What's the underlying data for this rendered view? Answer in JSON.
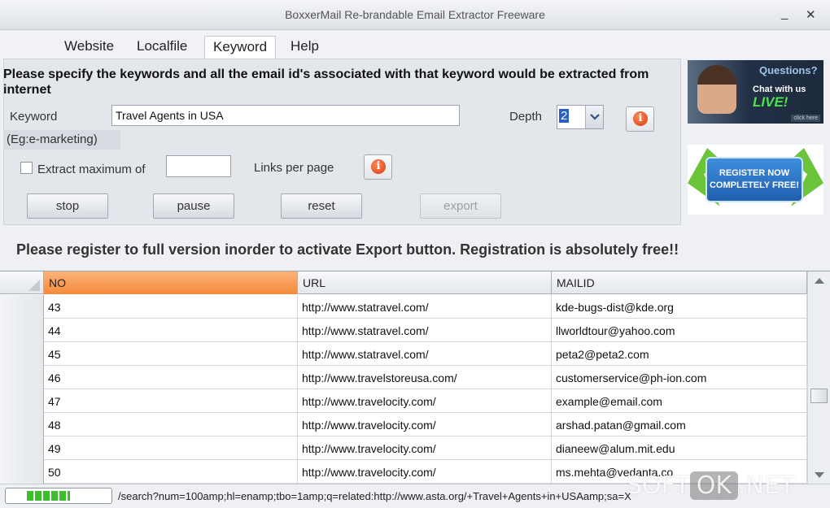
{
  "window": {
    "title": "BoxxerMail Re-brandable Email Extractor Freeware",
    "minimize": "_",
    "close": "✕"
  },
  "menu": [
    "Website",
    "Localfile",
    "Keyword",
    "Help"
  ],
  "menu_active": "Keyword",
  "keyword_panel": {
    "description": "Please specify the keywords and all the email id's associated with that keyword would be extracted from internet",
    "keyword_label": "Keyword",
    "keyword_value": "Travel Agents in USA",
    "depth_label": "Depth",
    "depth_value": "2",
    "example": "(Eg:e-marketing)",
    "extract_max_label": "Extract maximum of",
    "extract_max_value": "",
    "extract_max_checked": false,
    "links_per_page_label": "Links per page",
    "info_glyph": "i"
  },
  "buttons": {
    "stop": "stop",
    "pause": "pause",
    "reset": "reset",
    "export": "export"
  },
  "ads": {
    "questions": "Questions?",
    "chat": "Chat with us",
    "live": "LIVE!",
    "click_here": "click here",
    "register_line1": "REGISTER NOW",
    "register_line2": "COMPLETELY FREE!"
  },
  "notice": "Please register to full version inorder to activate Export button. Registration is absolutely free!!",
  "table": {
    "columns": [
      "NO",
      "URL",
      "MAILID"
    ],
    "sorted_column": "NO",
    "rows": [
      {
        "no": "43",
        "url": "http://www.statravel.com/",
        "mail": "kde-bugs-dist@kde.org"
      },
      {
        "no": "44",
        "url": "http://www.statravel.com/",
        "mail": "llworldtour@yahoo.com"
      },
      {
        "no": "45",
        "url": "http://www.statravel.com/",
        "mail": "peta2@peta2.com"
      },
      {
        "no": "46",
        "url": "http://www.travelstoreusa.com/",
        "mail": "customerservice@ph-ion.com"
      },
      {
        "no": "47",
        "url": "http://www.travelocity.com/",
        "mail": "example@email.com"
      },
      {
        "no": "48",
        "url": "http://www.travelocity.com/",
        "mail": "arshad.patan@gmail.com"
      },
      {
        "no": "49",
        "url": "http://www.travelocity.com/",
        "mail": "dianeew@alum.mit.edu"
      },
      {
        "no": "50",
        "url": "http://www.travelocity.com/",
        "mail": "ms.mehta@vedanta.co"
      }
    ]
  },
  "status": {
    "progress_fraction": 0.4,
    "url": "/search?num=100amp;hl=enamp;tbo=1amp;q=related:http://www.asta.org/+Travel+Agents+in+USAamp;sa=X"
  },
  "watermark": {
    "pre": "SOFT",
    "ok": "OK",
    "post": ".NET"
  },
  "colors": {
    "sorted_header": "#f28a3c",
    "progress": "#3bbd2c",
    "register": "#1f5fad"
  }
}
